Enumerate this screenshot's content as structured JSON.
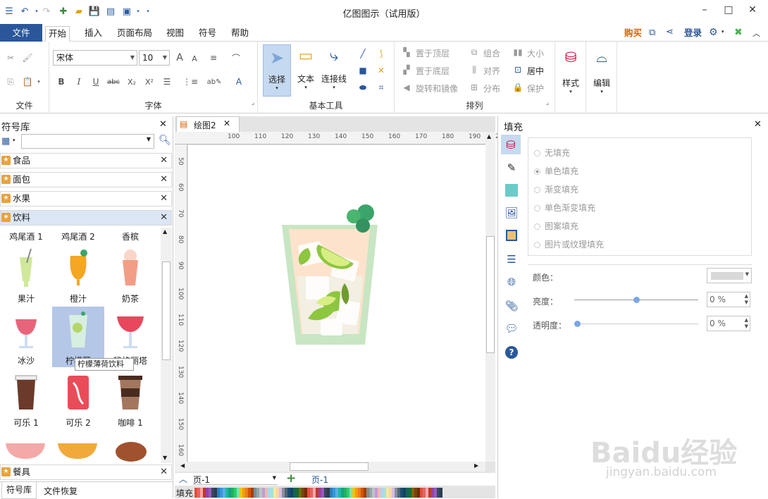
{
  "app": {
    "title": "亿图图示（试用版）"
  },
  "menu_tabs": [
    "文件",
    "开始",
    "插入",
    "页面布局",
    "视图",
    "符号",
    "帮助"
  ],
  "header_right": {
    "buy": "购买",
    "login": "登录"
  },
  "font": {
    "family": "宋体",
    "size": "10"
  },
  "ribbon": {
    "group_file": "文件",
    "group_font": "字体",
    "group_basic_tools": "基本工具",
    "group_arrange": "排列",
    "select_label": "选择",
    "text_label": "文本",
    "connector_label": "连接线",
    "style_label": "样式",
    "edit_label": "编辑",
    "bring_front": "置于顶层",
    "send_back": "置于底层",
    "rotate_mirror": "旋转和镜像",
    "group": "组合",
    "align": "对齐",
    "distribute": "分布",
    "size": "大小",
    "center": "居中",
    "protect": "保护"
  },
  "library": {
    "title": "符号库",
    "categories": [
      "食品",
      "面包",
      "水果",
      "饮料"
    ],
    "bottom_category": "餐具",
    "symbols": [
      {
        "name": "鸡尾酒 1"
      },
      {
        "name": "鸡尾酒 2"
      },
      {
        "name": "香槟"
      },
      {
        "name": "果汁"
      },
      {
        "name": "橙汁"
      },
      {
        "name": "奶茶"
      },
      {
        "name": "冰沙"
      },
      {
        "name": "柠檬薄荷饮料"
      },
      {
        "name": "玛格丽塔"
      },
      {
        "name": "可乐 1"
      },
      {
        "name": "可乐 2"
      },
      {
        "name": "咖啡 1"
      }
    ],
    "selected_label_truncated": "柠檬薄",
    "tooltip": "柠檬薄荷饮料",
    "visible_label_9": "玛格丽塔",
    "tabs": [
      "符号库",
      "文件恢复"
    ]
  },
  "document": {
    "tab": "绘图2",
    "page_label": "页-1",
    "page_tab": "页-1",
    "fill_label": "填充",
    "ruler_h": [
      "100",
      "110",
      "120",
      "130",
      "140",
      "150",
      "160",
      "170",
      "180",
      "190",
      "200"
    ],
    "ruler_v": [
      "50",
      "60",
      "70",
      "80",
      "90",
      "100",
      "110",
      "120",
      "130",
      "140",
      "150",
      "160"
    ]
  },
  "fill_panel": {
    "title": "填充",
    "options": [
      "无填充",
      "单色填充",
      "渐变填充",
      "单色渐变填充",
      "图案填充",
      "图片或纹理填充"
    ],
    "color_label": "颜色：",
    "brightness_label": "亮度：",
    "brightness_value": "0 %",
    "brightness_level": 0.5,
    "transparency_label": "透明度：",
    "transparency_value": "0 %",
    "transparency_level": 0
  },
  "watermark": {
    "brand": "Baidu经验",
    "url": "jingyan.baidu.com"
  },
  "colors": {
    "accent": "#2b579a",
    "buy": "#e06000",
    "drink_glass": "#c8e6c3",
    "lime": "#8dc63f",
    "mint": "#3aa56a"
  }
}
